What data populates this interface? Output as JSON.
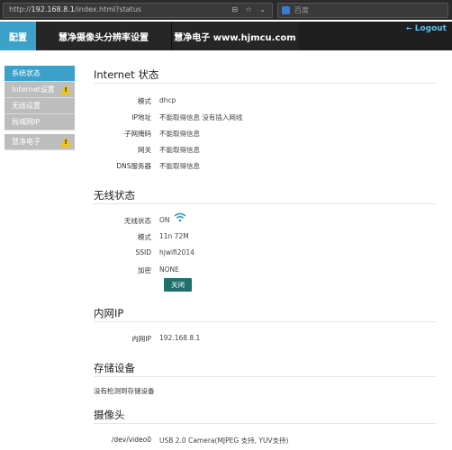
{
  "browser": {
    "url_prefix": "http://",
    "url_host": "192.168.8.1",
    "url_path": "/index.html?status",
    "url_icons": "⊟ ☆ ⌄",
    "search_placeholder": "百度"
  },
  "nav": {
    "config": "配置",
    "title": "慧净摄像头分辨率设置",
    "site": "慧净电子 www.hjmcu.com",
    "logout": "Logout",
    "logout_arrow": "←"
  },
  "sidebar": {
    "items": [
      {
        "label": "系统状态"
      },
      {
        "label": "Internet设置"
      },
      {
        "label": "无线设置"
      },
      {
        "label": "局域网IP"
      },
      {
        "label": "慧净电子"
      }
    ]
  },
  "internet": {
    "title": "Internet 状态",
    "rows": [
      {
        "label": "模式",
        "value": "dhcp"
      },
      {
        "label": "IP地址",
        "value": "不能取得信息 没有插入网线"
      },
      {
        "label": "子网掩码",
        "value": "不能取得信息"
      },
      {
        "label": "网关",
        "value": "不能取得信息"
      },
      {
        "label": "DNS服务器",
        "value": "不能取得信息"
      }
    ]
  },
  "wireless": {
    "title": "无线状态",
    "rows": [
      {
        "label": "无线状态",
        "value": "ON"
      },
      {
        "label": "模式",
        "value": "11n 72M"
      },
      {
        "label": "SSID",
        "value": "hjwifi2014"
      },
      {
        "label": "加密",
        "value": "NONE"
      }
    ],
    "close_button": "关闭"
  },
  "lan": {
    "title": "内网IP",
    "rows": [
      {
        "label": "内网IP",
        "value": "192.168.8.1"
      }
    ]
  },
  "storage": {
    "title": "存储设备",
    "text": "没有检测到存储设备"
  },
  "camera": {
    "title": "摄像头",
    "rows": [
      {
        "label": "/dev/video0",
        "value": "USB 2.0 Camera(MJPEG 支持, YUV支持)"
      }
    ]
  },
  "colors": {
    "accent": "#3ba1c8",
    "nav_bg": "#1f1f1f",
    "button": "#1f6f6d",
    "warning": "#f1c40f"
  }
}
